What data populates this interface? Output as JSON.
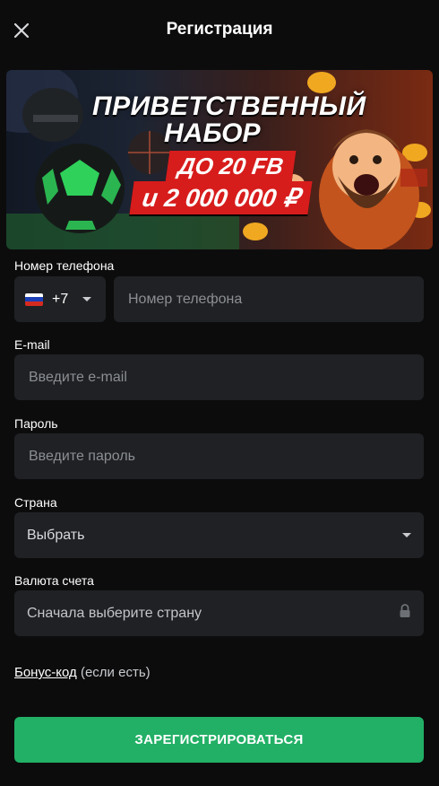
{
  "header": {
    "title": "Регистрация",
    "close_icon": "close-icon"
  },
  "banner": {
    "line1": "ПРИВЕТСТВЕННЫЙ",
    "line2": "НАБОР",
    "tag1": "ДО 20 FB",
    "tag2": "и 2 000 000 ₽"
  },
  "phone": {
    "label": "Номер телефона",
    "code": "+7",
    "placeholder": "Номер телефона",
    "value": ""
  },
  "email": {
    "label": "E-mail",
    "placeholder": "Введите e-mail",
    "value": ""
  },
  "password": {
    "label": "Пароль",
    "placeholder": "Введите пароль",
    "value": ""
  },
  "country": {
    "label": "Страна",
    "selected": "Выбрать"
  },
  "currency": {
    "label": "Валюта счета",
    "selected": "Сначала выберите страну",
    "lock_icon": "lock-icon"
  },
  "bonus": {
    "link": "Бонус-код",
    "note": "(если есть)"
  },
  "submit": {
    "label": "ЗАРЕГИСТРИРОВАТЬСЯ"
  },
  "colors": {
    "background": "#0c0c0d",
    "field": "#1f2124",
    "accent": "#22b066"
  }
}
